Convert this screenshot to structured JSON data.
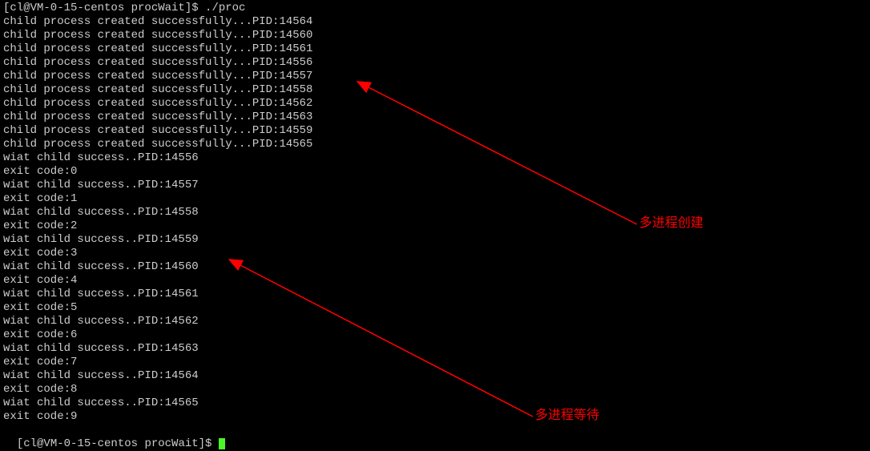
{
  "prompt1": "[cl@VM-0-15-centos procWait]$ ./proc",
  "children": [
    "child process created successfully...PID:14564",
    "child process created successfully...PID:14560",
    "child process created successfully...PID:14561",
    "child process created successfully...PID:14556",
    "child process created successfully...PID:14557",
    "child process created successfully...PID:14558",
    "child process created successfully...PID:14562",
    "child process created successfully...PID:14563",
    "child process created successfully...PID:14559",
    "child process created successfully...PID:14565"
  ],
  "waits": [
    {
      "msg": "wiat child success..PID:14556",
      "exit": "exit code:0"
    },
    {
      "msg": "wiat child success..PID:14557",
      "exit": "exit code:1"
    },
    {
      "msg": "wiat child success..PID:14558",
      "exit": "exit code:2"
    },
    {
      "msg": "wiat child success..PID:14559",
      "exit": "exit code:3"
    },
    {
      "msg": "wiat child success..PID:14560",
      "exit": "exit code:4"
    },
    {
      "msg": "wiat child success..PID:14561",
      "exit": "exit code:5"
    },
    {
      "msg": "wiat child success..PID:14562",
      "exit": "exit code:6"
    },
    {
      "msg": "wiat child success..PID:14563",
      "exit": "exit code:7"
    },
    {
      "msg": "wiat child success..PID:14564",
      "exit": "exit code:8"
    },
    {
      "msg": "wiat child success..PID:14565",
      "exit": "exit code:9"
    }
  ],
  "prompt2": "[cl@VM-0-15-centos procWait]$ ",
  "annotation1": "多进程创建",
  "annotation2": "多进程等待"
}
